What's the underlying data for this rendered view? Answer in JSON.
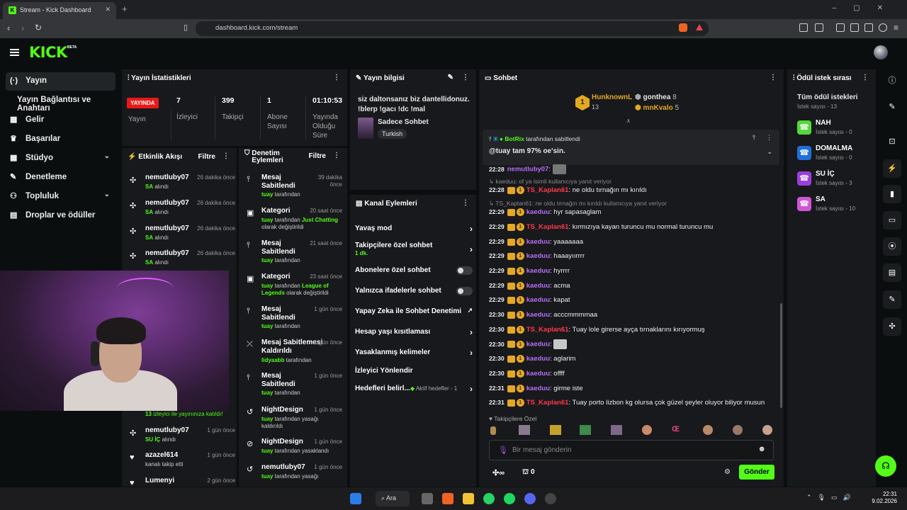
{
  "browser": {
    "tab_title": "Stream - Kick Dashboard",
    "url": "dashboard.kick.com/stream"
  },
  "header": {
    "logo": "KICK",
    "beta": "BETA"
  },
  "nav": {
    "items": [
      {
        "label": "Yayın",
        "icon": "(·)"
      },
      {
        "label": "Yayın Bağlantısı ve Anahtarı"
      },
      {
        "label": "Gelir",
        "icon": "▦"
      },
      {
        "label": "Başarılar",
        "icon": "🏆"
      },
      {
        "label": "Stüdyo",
        "icon": "▦"
      },
      {
        "label": "Denetleme",
        "icon": "🔧"
      },
      {
        "label": "Topluluk",
        "icon": "👥"
      },
      {
        "label": "Droplar ve ödüller",
        "icon": "▤"
      }
    ]
  },
  "stats": {
    "title": "Yayın İstatistikleri",
    "live_badge": "YAYINDA",
    "live_label": "Yayın",
    "viewers_value": "7",
    "viewers_label": "İzleyici",
    "followers_value": "399",
    "followers_label": "Takipçi",
    "subs_value": "1",
    "subs_label": "Abone Sayısı",
    "uptime_value": "01:10:53",
    "uptime_label": "Yayında Olduğu Süre"
  },
  "stream_info": {
    "title": "Yayın bilgisi",
    "description": "siz daltonsanız biz dantellidonuz. !blerp !gacı !dc !mal",
    "category": "Sadece Sohbet",
    "tag": "Turkish"
  },
  "activity": {
    "title": "Etkinlik Akışı",
    "filter": "Filtre",
    "items": [
      {
        "user": "nemutluby07",
        "time": "26 dakika önce",
        "reward": "SA",
        "suffix": " alındı"
      },
      {
        "user": "nemutluby07",
        "time": "26 dakika önce",
        "reward": "SA",
        "suffix": " alındı"
      },
      {
        "user": "nemutluby07",
        "time": "26 dakika önce",
        "reward": "SA",
        "suffix": " alındı"
      },
      {
        "user": "nemutluby07",
        "time": "26 dakika önce",
        "reward": "SA",
        "suffix": " alındı"
      }
    ],
    "raid_count": "13",
    "raid_text": " izleyici ile yayınınıza katıldı!",
    "items2": [
      {
        "user": "nemutluby07",
        "time": "1 gün önce",
        "reward": "SU İÇ",
        "suffix": " alındı"
      },
      {
        "user": "azazel614",
        "time": "1 gün önce",
        "text": "kanalı takip etti"
      },
      {
        "user": "Lumenyi",
        "time": "2 gün önce",
        "text": ""
      }
    ]
  },
  "moderation": {
    "title": "Denetim Eylemleri",
    "filter": "Filtre",
    "items": [
      {
        "title": "Mesaj Sabitlendi",
        "time": "39 dakika önce",
        "user": "tuay",
        "text": " tarafından"
      },
      {
        "title": "Kategori",
        "time": "20 saat önce",
        "user": "tuay",
        "text": " tarafından ",
        "extra": "Just Chatting",
        "text2": " olarak değiştirildi"
      },
      {
        "title": "Mesaj Sabitlendi",
        "time": "21 saat önce",
        "user": "tuay",
        "text": " tarafından"
      },
      {
        "title": "Kategori",
        "time": "23 saat önce",
        "user": "tuay",
        "text": " tarafından ",
        "extra": "League of Legends",
        "text2": " olarak değiştirildi"
      },
      {
        "title": "Mesaj Sabitlendi",
        "time": "1 gün önce",
        "user": "tuay",
        "text": " tarafından"
      },
      {
        "title": "Mesaj Sabitlemesi Kaldırıldı",
        "time": "1 gün önce",
        "user": "lidyaabb",
        "text": " tarafından"
      },
      {
        "title": "Mesaj Sabitlendi",
        "time": "1 gün önce",
        "user": "tuay",
        "text": " tarafından"
      },
      {
        "title": "NightDesign",
        "time": "1 gün önce",
        "user": "tuay",
        "text": " tarafından yasağı kaldırıldı"
      },
      {
        "title": "NightDesign",
        "time": "1 gün önce",
        "user": "tuay",
        "text": " tarafından yasaklandı"
      },
      {
        "title": "nemutluby07",
        "time": "1 gün önce",
        "user": "tuay",
        "text": " tarafından yasağı"
      }
    ]
  },
  "channel_actions": {
    "title": "Kanal Eylemleri",
    "slow": "Yavaş mod",
    "followers_only": "Takipçilere özel sohbet",
    "followers_only_sub": "1 dk.",
    "subs_only": "Abonelere özel sohbet",
    "emotes_only": "Yalnızca ifadelerle sohbet",
    "ai_mod": "Yapay Zeka ile Sohbet Denetimi",
    "account_age": "Hesap yaşı kısıtlaması",
    "banned_words": "Yasaklanmış kelimeler",
    "redirect": "İzleyici Yönlendir",
    "goals": "Hedefleri belirl...",
    "goals_status": "Aktif hedefler - 1"
  },
  "chat": {
    "title": "Sohbet",
    "top_gifters": [
      {
        "name": "HunknownL",
        "count": "13"
      },
      {
        "name": "gonthea",
        "count": "8"
      },
      {
        "name": "mnKvalo",
        "count": "5"
      }
    ],
    "pinned_by": "BotRix",
    "pinned_suffix": " tarafından sabitlendi",
    "pinned_text": "@tuay tam 97% oe'sin.",
    "messages": [
      {
        "time": "22:28",
        "user": "nemutluby07",
        "text": ":",
        "type": "top"
      },
      {
        "reply": "kaeduu: of ya isimli kullanıcıya yanıt veriyor"
      },
      {
        "time": "22:28",
        "user": "TS_Kaplan61",
        "text": ": ne oldu tırnağın mı kırıldı",
        "type": "red"
      },
      {
        "reply": "TS_Kaplan61: ne oldu tırnağın mı kırıldı kullanıcıya yanıt veriyor"
      },
      {
        "time": "22:29",
        "user": "kaeduu",
        "text": ": hyr sapasaglam"
      },
      {
        "time": "22:29",
        "user": "TS_Kaplan61",
        "text": ": kırmızıya kayan turuncu mu normal turuncu mu",
        "type": "red"
      },
      {
        "time": "22:29",
        "user": "kaeduu",
        "text": ": yaaaaaaa"
      },
      {
        "time": "22:29",
        "user": "kaeduu",
        "text": ": haaayıırrrr"
      },
      {
        "time": "22:29",
        "user": "kaeduu",
        "text": ": hyrrrr"
      },
      {
        "time": "22:29",
        "user": "kaeduu",
        "text": ": acma"
      },
      {
        "time": "22:29",
        "user": "kaeduu",
        "text": ": kapat"
      },
      {
        "time": "22:30",
        "user": "kaeduu",
        "text": ": acccmmmmaa"
      },
      {
        "time": "22:30",
        "user": "TS_Kaplan61",
        "text": ": Tuay lole girerse ayça tırnaklarını kırıyormuş",
        "type": "red"
      },
      {
        "time": "22:30",
        "user": "kaeduu",
        "text": ":",
        "emote": true
      },
      {
        "time": "22:30",
        "user": "kaeduu",
        "text": ": aglarim"
      },
      {
        "time": "22:30",
        "user": "kaeduu",
        "text": ": offff"
      },
      {
        "time": "22:31",
        "user": "kaeduu",
        "text": ": girme iste"
      },
      {
        "time": "22:31",
        "user": "TS_Kaplan61",
        "text": ": Tuay porto lizbon kg olursa çok güzel şeyler oluyor biliyor musun",
        "type": "red"
      }
    ],
    "followers_label": "Takipçilere Özel",
    "input_placeholder": "Bir mesaj gönderin",
    "points": "∞",
    "gift_count": "0",
    "send": "Gönder"
  },
  "rewards": {
    "title": "Ödül istek sırası",
    "all": "Tüm ödül istekleri",
    "count_label": "İstek sayısı - 13",
    "items": [
      {
        "name": "NAH",
        "count": "İstek sayısı - 0",
        "color": "#53d93a"
      },
      {
        "name": "DOMALMA",
        "count": "İstek sayısı - 0",
        "color": "#1f6fd9"
      },
      {
        "name": "SU İÇ",
        "count": "İstek sayısı - 3",
        "color": "#9b3ee0"
      },
      {
        "name": "SA",
        "count": "İstek sayısı - 10",
        "color": "#d056d6"
      }
    ]
  },
  "taskbar": {
    "search": "Ara",
    "time": "22:31",
    "date": "9.02.2026"
  }
}
